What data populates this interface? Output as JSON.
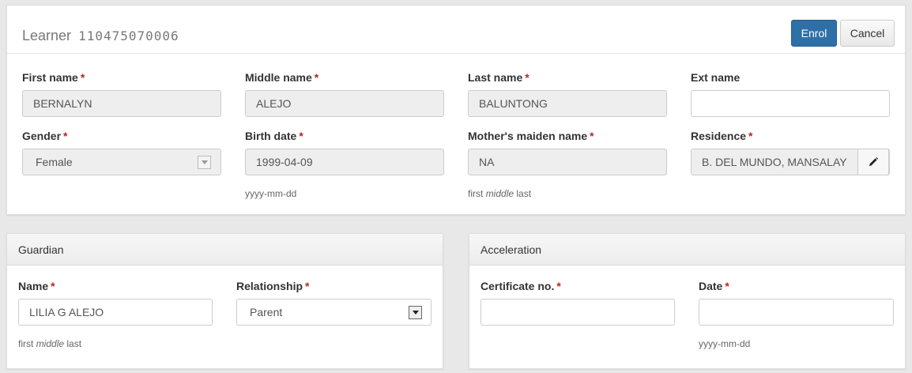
{
  "learner": {
    "title": "Learner",
    "lrn": "110475070006",
    "enrol_label": "Enrol",
    "cancel_label": "Cancel",
    "required_mark": "*",
    "fields": {
      "first_name": {
        "label": "First name",
        "value": "BERNALYN"
      },
      "middle_name": {
        "label": "Middle name",
        "value": "ALEJO"
      },
      "last_name": {
        "label": "Last name",
        "value": "BALUNTONG"
      },
      "ext_name": {
        "label": "Ext name",
        "value": ""
      },
      "gender": {
        "label": "Gender",
        "value": "Female"
      },
      "birth_date": {
        "label": "Birth date",
        "value": "1999-04-09",
        "hint": "yyyy-mm-dd"
      },
      "mothers_maiden_name": {
        "label": "Mother's maiden name",
        "value": "NA",
        "hint_first": "first",
        "hint_middle": "middle",
        "hint_last": "last"
      },
      "residence": {
        "label": "Residence",
        "value": "B. DEL MUNDO, MANSALAY",
        "edit_icon": "pencil-icon"
      }
    }
  },
  "guardian": {
    "title": "Guardian",
    "name": {
      "label": "Name",
      "value": "LILIA G ALEJO",
      "hint_first": "first",
      "hint_middle": "middle",
      "hint_last": "last"
    },
    "relationship": {
      "label": "Relationship",
      "value": "Parent"
    }
  },
  "acceleration": {
    "title": "Acceleration",
    "certificate_no": {
      "label": "Certificate no.",
      "value": ""
    },
    "date": {
      "label": "Date",
      "value": "",
      "hint": "yyyy-mm-dd"
    }
  }
}
